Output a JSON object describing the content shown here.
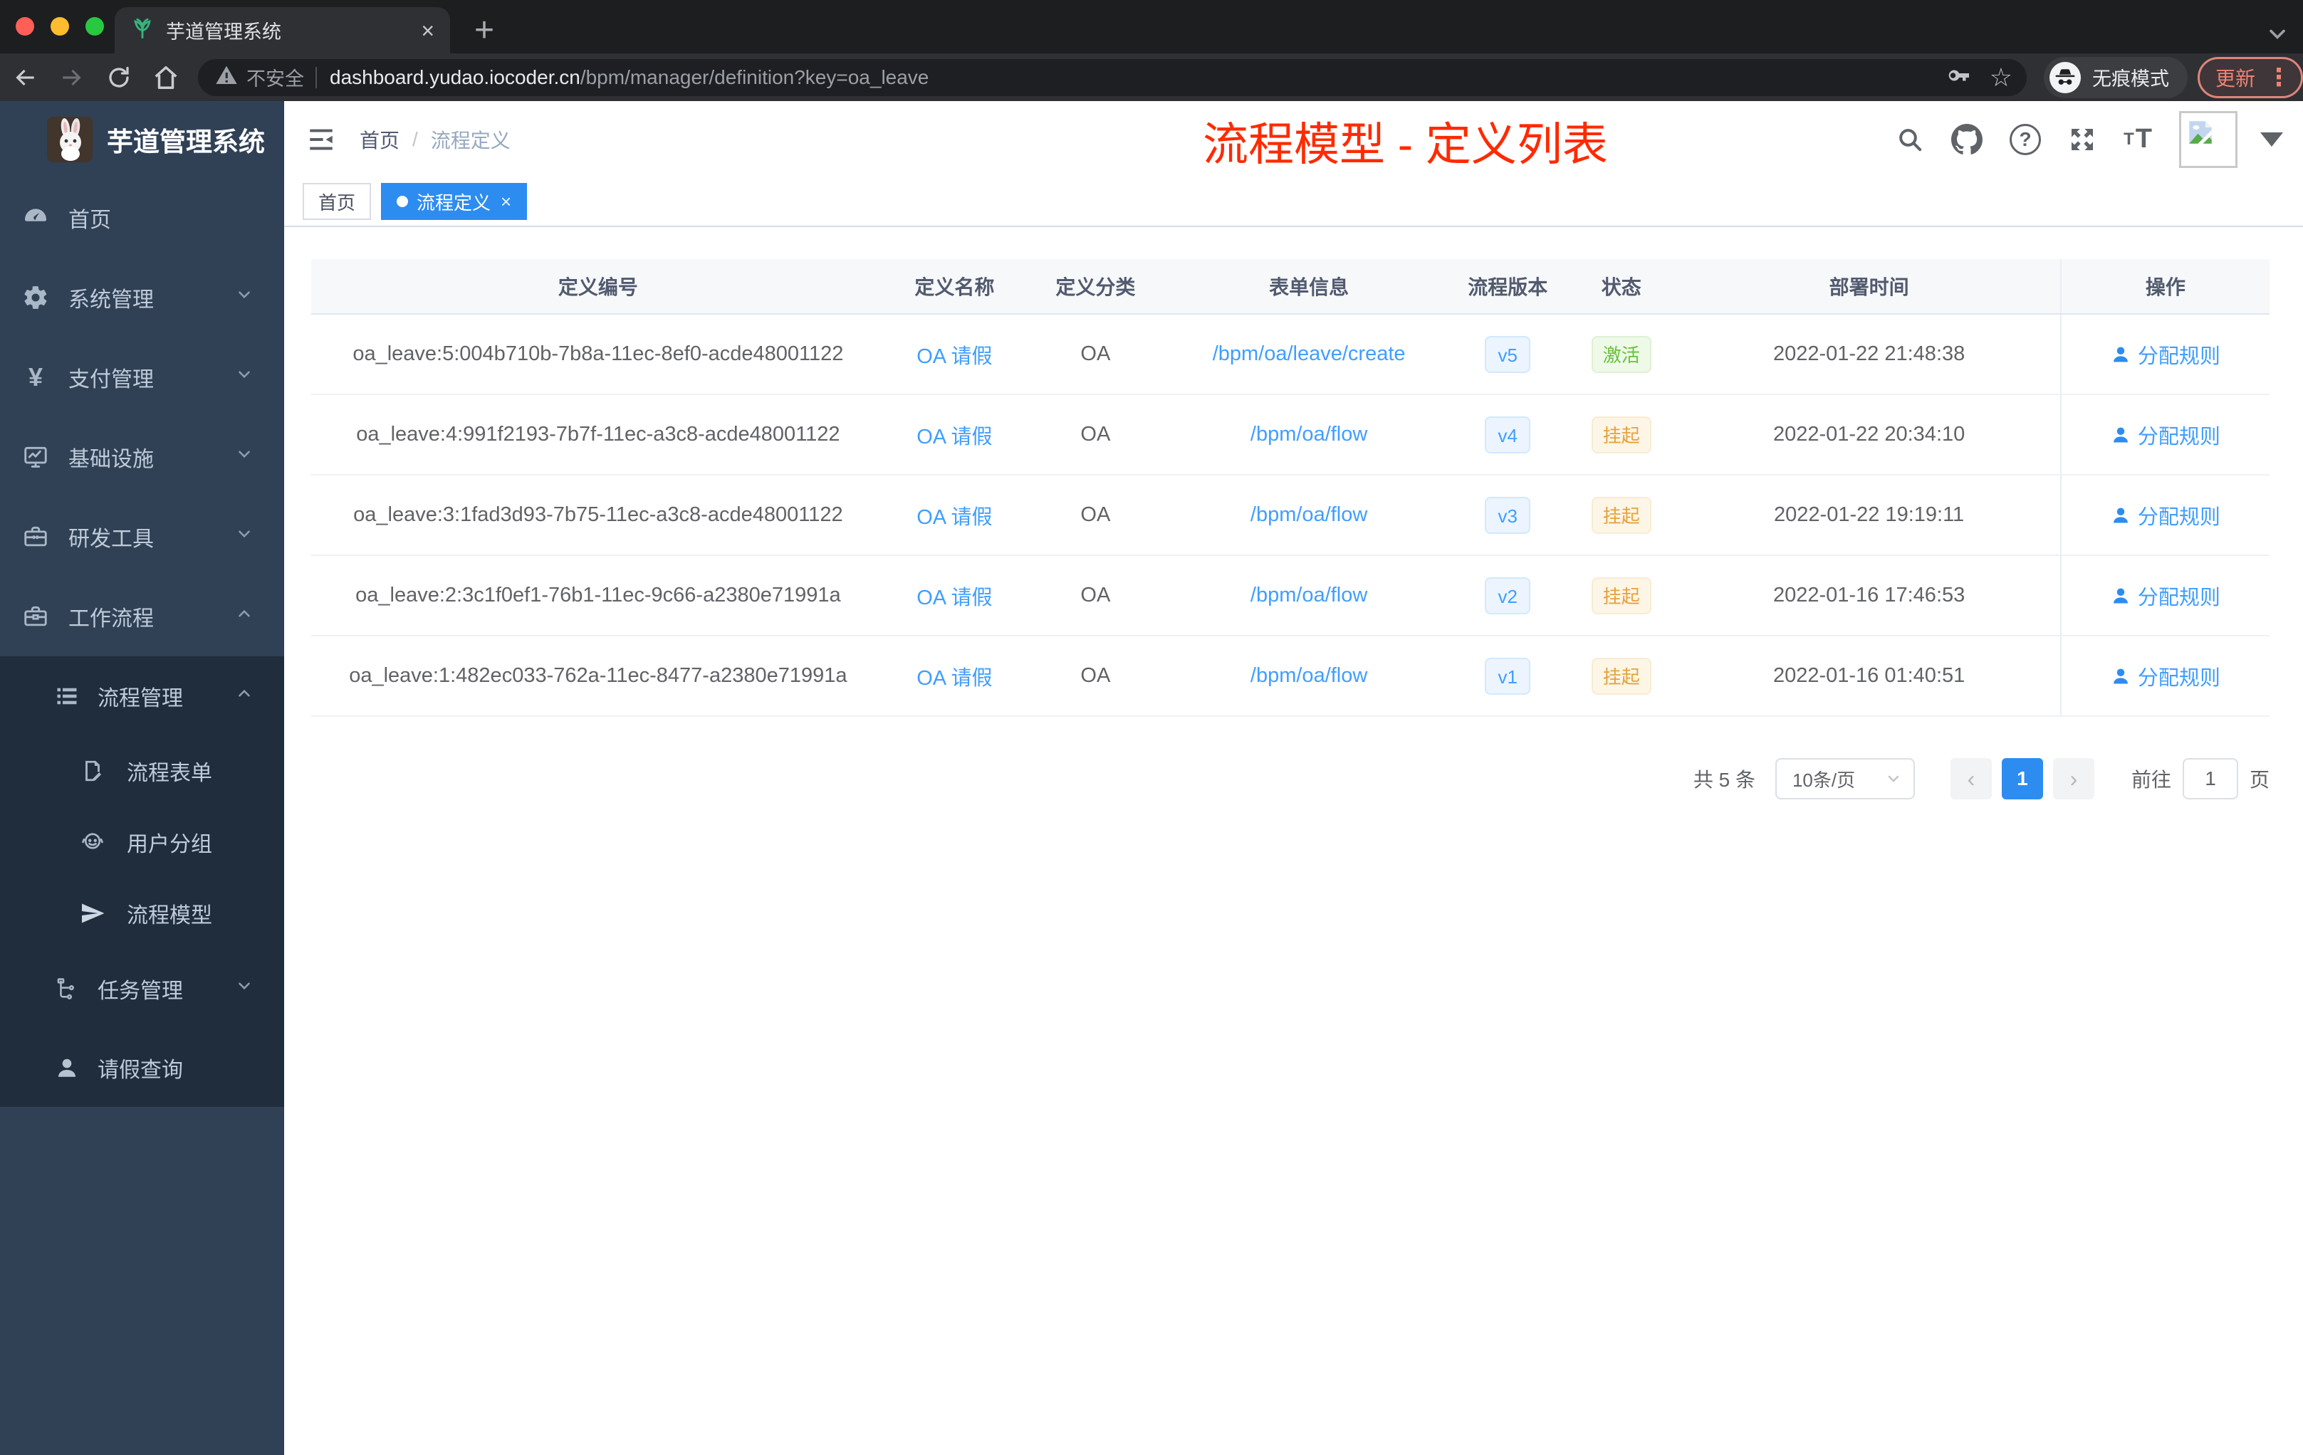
{
  "colors": {
    "primary_link": "#409eff",
    "primary_solid": "#2d8cf0",
    "success": "#67c23a",
    "warning": "#e6a23c",
    "annotation_red": "#ff2a00",
    "sidebar_bg": "#304156",
    "submenu_bg": "#1f2d3d",
    "chrome_dark": "#1d1e20",
    "update_red": "#ef8274"
  },
  "browser": {
    "tab_title": "芋道管理系统",
    "security_label": "不安全",
    "url_host": "dashboard.yudao.iocoder.cn",
    "url_path": "/bpm/manager/definition?key=oa_leave",
    "incognito_label": "无痕模式",
    "update_label": "更新"
  },
  "icons": {
    "tab_close": "×",
    "new_tab": "+",
    "tag_close": "×",
    "question": "?",
    "yen": "¥",
    "star": "☆",
    "menu_dots": "⋮",
    "font_small": "T",
    "font_big": "T",
    "prev": "‹",
    "next": "›"
  },
  "sidebar": {
    "logo_title": "芋道管理系统",
    "menu": [
      {
        "label": "首页",
        "icon": "dashboard-icon"
      },
      {
        "label": "系统管理",
        "icon": "gear-icon",
        "arrow": "down"
      },
      {
        "label": "支付管理",
        "icon": "yen-icon",
        "arrow": "down"
      },
      {
        "label": "基础设施",
        "icon": "monitor-icon",
        "arrow": "down"
      },
      {
        "label": "研发工具",
        "icon": "toolbox-icon",
        "arrow": "down"
      },
      {
        "label": "工作流程",
        "icon": "workflow-icon",
        "arrow": "up"
      }
    ],
    "submenu": [
      {
        "label": "流程管理",
        "icon": "list-tree-icon",
        "arrow": "up",
        "level": 1
      },
      {
        "label": "流程表单",
        "icon": "form-icon",
        "level": 2
      },
      {
        "label": "用户分组",
        "icon": "user-group-icon",
        "level": 2
      },
      {
        "label": "流程模型",
        "icon": "paper-plane-icon",
        "level": 2
      },
      {
        "label": "任务管理",
        "icon": "task-tree-icon",
        "arrow": "down",
        "level": 1
      },
      {
        "label": "请假查询",
        "icon": "person-icon",
        "level": 1
      }
    ]
  },
  "navbar": {
    "breadcrumb_home": "首页",
    "breadcrumb_separator": "/",
    "breadcrumb_current": "流程定义"
  },
  "annotation": "流程模型 - 定义列表",
  "tags": [
    {
      "label": "首页",
      "active": false
    },
    {
      "label": "流程定义",
      "active": true
    }
  ],
  "table": {
    "columns": [
      "定义编号",
      "定义名称",
      "定义分类",
      "表单信息",
      "流程版本",
      "状态",
      "部署时间",
      "操作"
    ],
    "rows": [
      {
        "id": "oa_leave:5:004b710b-7b8a-11ec-8ef0-acde48001122",
        "name": "OA 请假",
        "category": "OA",
        "form": "/bpm/oa/leave/create",
        "version": "v5",
        "status": "激活",
        "status_type": "success",
        "deploy_time": "2022-01-22 21:48:38",
        "action": "分配规则"
      },
      {
        "id": "oa_leave:4:991f2193-7b7f-11ec-a3c8-acde48001122",
        "name": "OA 请假",
        "category": "OA",
        "form": "/bpm/oa/flow",
        "version": "v4",
        "status": "挂起",
        "status_type": "warning",
        "deploy_time": "2022-01-22 20:34:10",
        "action": "分配规则"
      },
      {
        "id": "oa_leave:3:1fad3d93-7b75-11ec-a3c8-acde48001122",
        "name": "OA 请假",
        "category": "OA",
        "form": "/bpm/oa/flow",
        "version": "v3",
        "status": "挂起",
        "status_type": "warning",
        "deploy_time": "2022-01-22 19:19:11",
        "action": "分配规则"
      },
      {
        "id": "oa_leave:2:3c1f0ef1-76b1-11ec-9c66-a2380e71991a",
        "name": "OA 请假",
        "category": "OA",
        "form": "/bpm/oa/flow",
        "version": "v2",
        "status": "挂起",
        "status_type": "warning",
        "deploy_time": "2022-01-16 17:46:53",
        "action": "分配规则"
      },
      {
        "id": "oa_leave:1:482ec033-762a-11ec-8477-a2380e71991a",
        "name": "OA 请假",
        "category": "OA",
        "form": "/bpm/oa/flow",
        "version": "v1",
        "status": "挂起",
        "status_type": "warning",
        "deploy_time": "2022-01-16 01:40:51",
        "action": "分配规则"
      }
    ]
  },
  "pagination": {
    "total_text": "共 5 条",
    "page_size": "10条/页",
    "current_page": "1",
    "goto_label": "前往",
    "goto_value": "1",
    "page_unit": "页"
  }
}
